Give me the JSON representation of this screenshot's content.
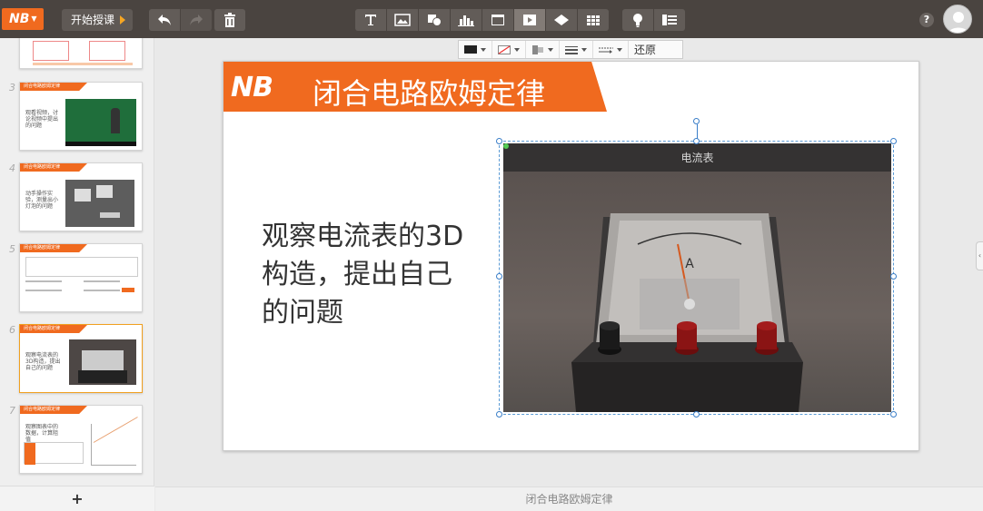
{
  "app": {
    "logo_text": "NB",
    "start_button_label": "开始授课",
    "help_label": "?"
  },
  "toolbar": {
    "icons": [
      "undo-icon",
      "redo-icon",
      "trash-icon",
      "text-icon",
      "image-icon",
      "shape-icon",
      "chart-icon",
      "window-icon",
      "media-icon",
      "fill-shape-icon",
      "table-icon",
      "lightbulb-icon",
      "list-icon"
    ]
  },
  "format_bar": {
    "restore_label": "还原"
  },
  "sidebar": {
    "add_label": "+",
    "slides": [
      {
        "number": "",
        "band": "",
        "text": ""
      },
      {
        "number": "3",
        "band": "闭合电路欧姆定律",
        "text": "观看视频，讨论视频中提出的问题"
      },
      {
        "number": "4",
        "band": "闭合电路欧姆定律",
        "text": "动手操作实验，测量出小灯泡的问题"
      },
      {
        "number": "5",
        "band": "闭合电路欧姆定律",
        "text": ""
      },
      {
        "number": "6",
        "band": "闭合电路欧姆定律",
        "text": "观察电流表的3D构造，提出自己的问题"
      },
      {
        "number": "7",
        "band": "闭合电路欧姆定律",
        "text": "观察图表中的数据，计算阻值"
      }
    ]
  },
  "slide": {
    "logo_text": "NB",
    "title": "闭合电路欧姆定律",
    "body_text": "观察电流表的3D构造，提出自己的问题",
    "image_header": "电流表"
  },
  "footer": {
    "slide_title": "闭合电路欧姆定律"
  },
  "colors": {
    "accent": "#f06a1f",
    "toolbar_bg": "#4a4440",
    "selection": "#3a7ec8"
  }
}
